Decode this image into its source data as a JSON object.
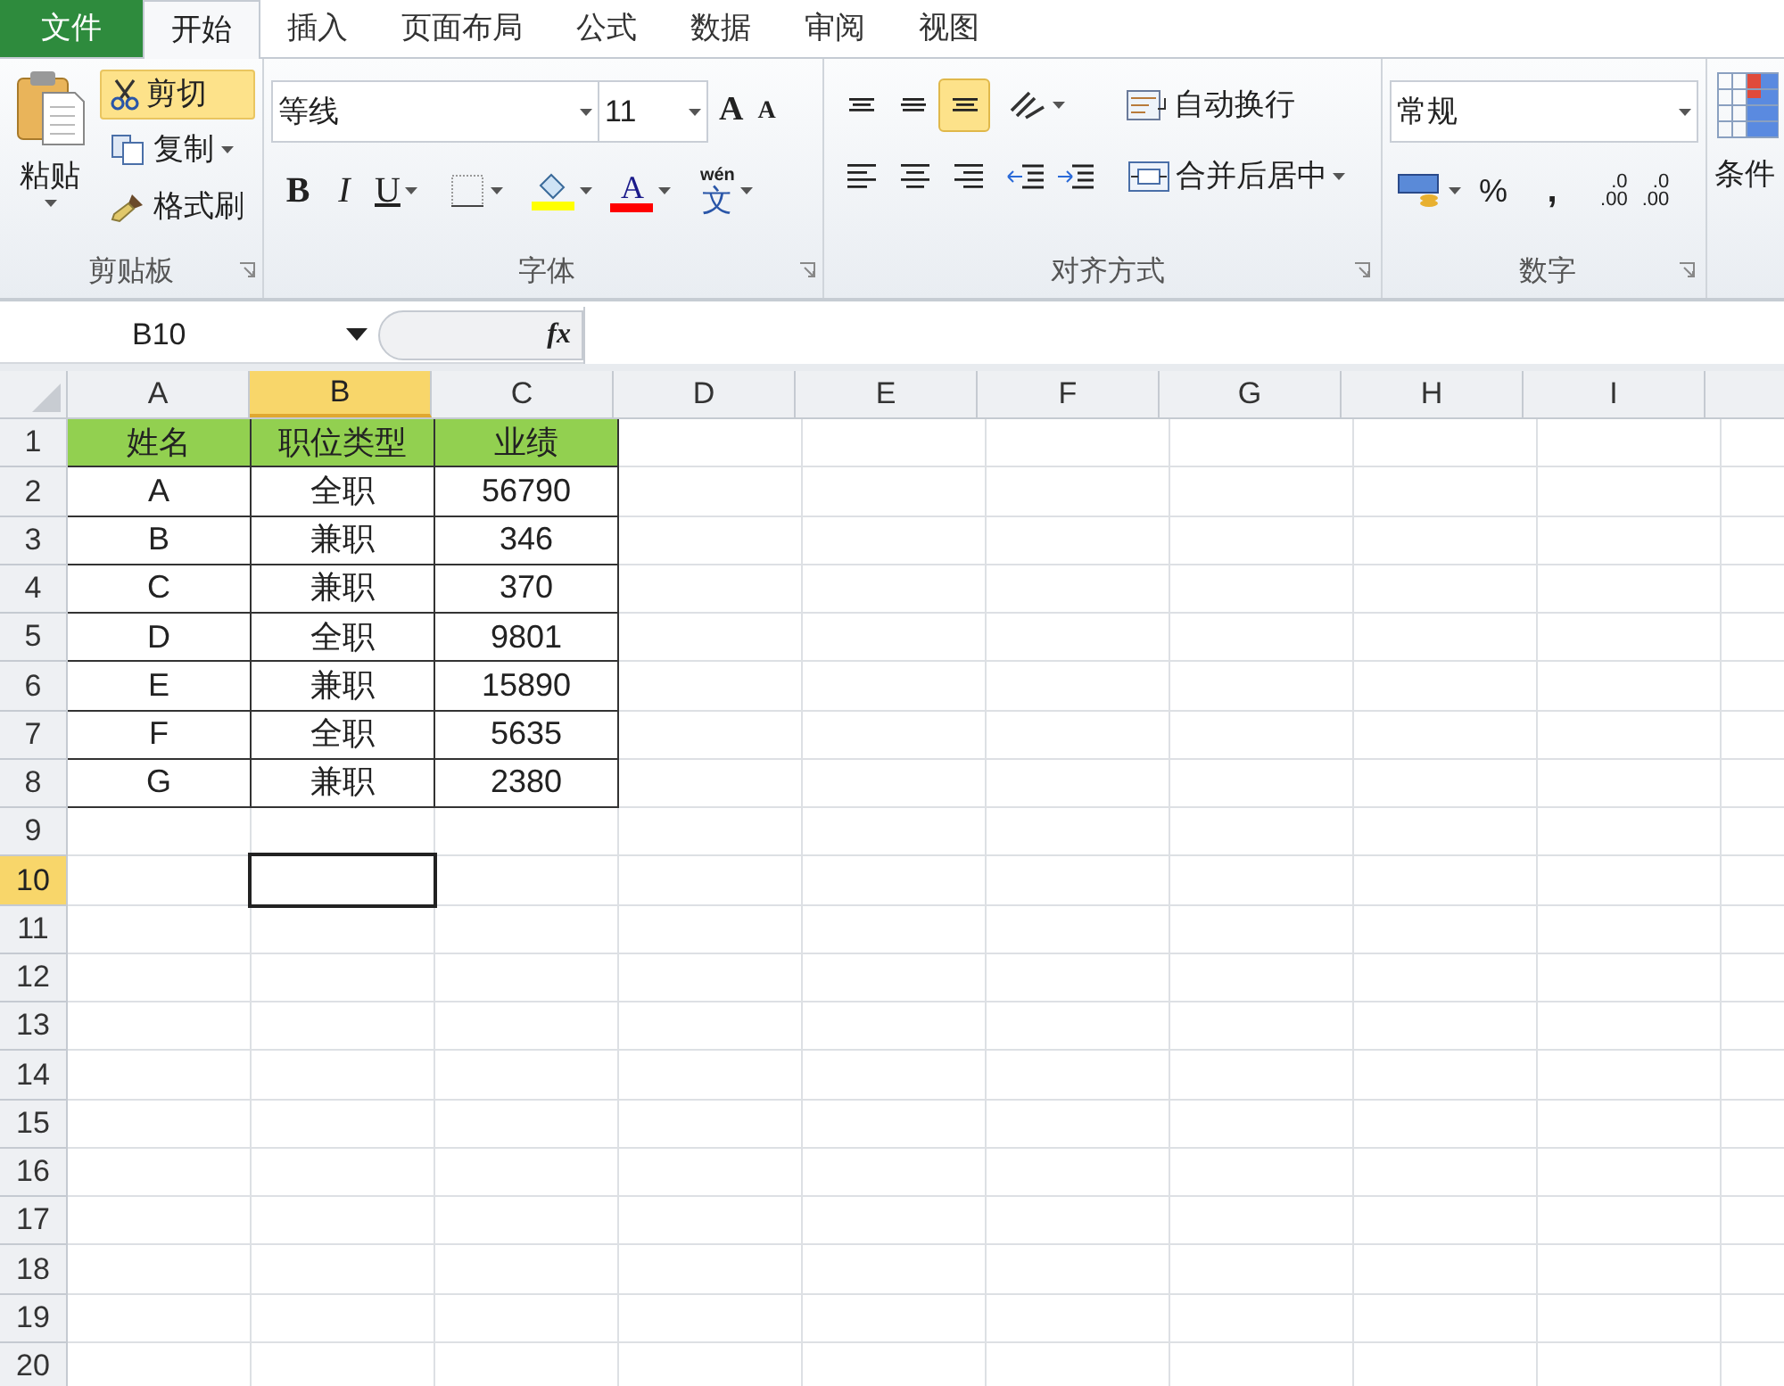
{
  "menu_tabs": [
    {
      "label": "文件",
      "kind": "file",
      "selected": false
    },
    {
      "label": "开始",
      "kind": "tab",
      "selected": true
    },
    {
      "label": "插入",
      "kind": "tab",
      "selected": false
    },
    {
      "label": "页面布局",
      "kind": "tab",
      "selected": false
    },
    {
      "label": "公式",
      "kind": "tab",
      "selected": false
    },
    {
      "label": "数据",
      "kind": "tab",
      "selected": false
    },
    {
      "label": "审阅",
      "kind": "tab",
      "selected": false
    },
    {
      "label": "视图",
      "kind": "tab",
      "selected": false
    }
  ],
  "clipboard": {
    "label": "剪贴板",
    "paste": "粘贴",
    "cut": {
      "label": "剪切",
      "highlighted": true
    },
    "copy": "复制",
    "format_painter": "格式刷"
  },
  "font": {
    "label": "字体",
    "font_name": "等线",
    "font_size": "11",
    "grow": "A",
    "shrink": "A",
    "bold": "B",
    "italic": "I",
    "underline": "U",
    "font_color": "A",
    "phonetic_top": "wén",
    "phonetic_bottom": "文"
  },
  "alignment": {
    "label": "对齐方式",
    "wrap_text": "自动换行",
    "merge_center": "合并后居中",
    "vertical": [
      {
        "kind": "top",
        "selected": false
      },
      {
        "kind": "middle",
        "selected": false
      },
      {
        "kind": "bottom",
        "selected": true
      }
    ],
    "horizontal": [
      {
        "kind": "left",
        "selected": false
      },
      {
        "kind": "center",
        "selected": false
      },
      {
        "kind": "right",
        "selected": false
      }
    ]
  },
  "number": {
    "label": "数字",
    "format": "常规",
    "percent": "%",
    "comma": ",",
    "increase_decimal": [
      ".0",
      ".00"
    ],
    "decrease_decimal": [
      ".0",
      ".00"
    ]
  },
  "styles": {
    "conditional": "条件"
  },
  "name_box": "B10",
  "formula_button": "fx",
  "columns": [
    {
      "label": "A",
      "selected": false
    },
    {
      "label": "B",
      "selected": true
    },
    {
      "label": "C",
      "selected": false
    },
    {
      "label": "D",
      "selected": false
    },
    {
      "label": "E",
      "selected": false
    },
    {
      "label": "F",
      "selected": false
    },
    {
      "label": "G",
      "selected": false
    },
    {
      "label": "H",
      "selected": false
    },
    {
      "label": "I",
      "selected": false
    }
  ],
  "row_headers": [
    {
      "label": "1",
      "selected": false
    },
    {
      "label": "2",
      "selected": false
    },
    {
      "label": "3",
      "selected": false
    },
    {
      "label": "4",
      "selected": false
    },
    {
      "label": "5",
      "selected": false
    },
    {
      "label": "6",
      "selected": false
    },
    {
      "label": "7",
      "selected": false
    },
    {
      "label": "8",
      "selected": false
    },
    {
      "label": "9",
      "selected": false
    },
    {
      "label": "10",
      "selected": true
    },
    {
      "label": "11",
      "selected": false
    },
    {
      "label": "12",
      "selected": false
    },
    {
      "label": "13",
      "selected": false
    },
    {
      "label": "14",
      "selected": false
    },
    {
      "label": "15",
      "selected": false
    },
    {
      "label": "16",
      "selected": false
    },
    {
      "label": "17",
      "selected": false
    },
    {
      "label": "18",
      "selected": false
    },
    {
      "label": "19",
      "selected": false
    },
    {
      "label": "20",
      "selected": false
    }
  ],
  "table": {
    "header": [
      "姓名",
      "职位类型",
      "业绩"
    ],
    "rows": [
      [
        "A",
        "全职",
        "56790"
      ],
      [
        "B",
        "兼职",
        "346"
      ],
      [
        "C",
        "兼职",
        "370"
      ],
      [
        "D",
        "全职",
        "9801"
      ],
      [
        "E",
        "兼职",
        "15890"
      ],
      [
        "F",
        "全职",
        "5635"
      ],
      [
        "G",
        "兼职",
        "2380"
      ]
    ]
  }
}
